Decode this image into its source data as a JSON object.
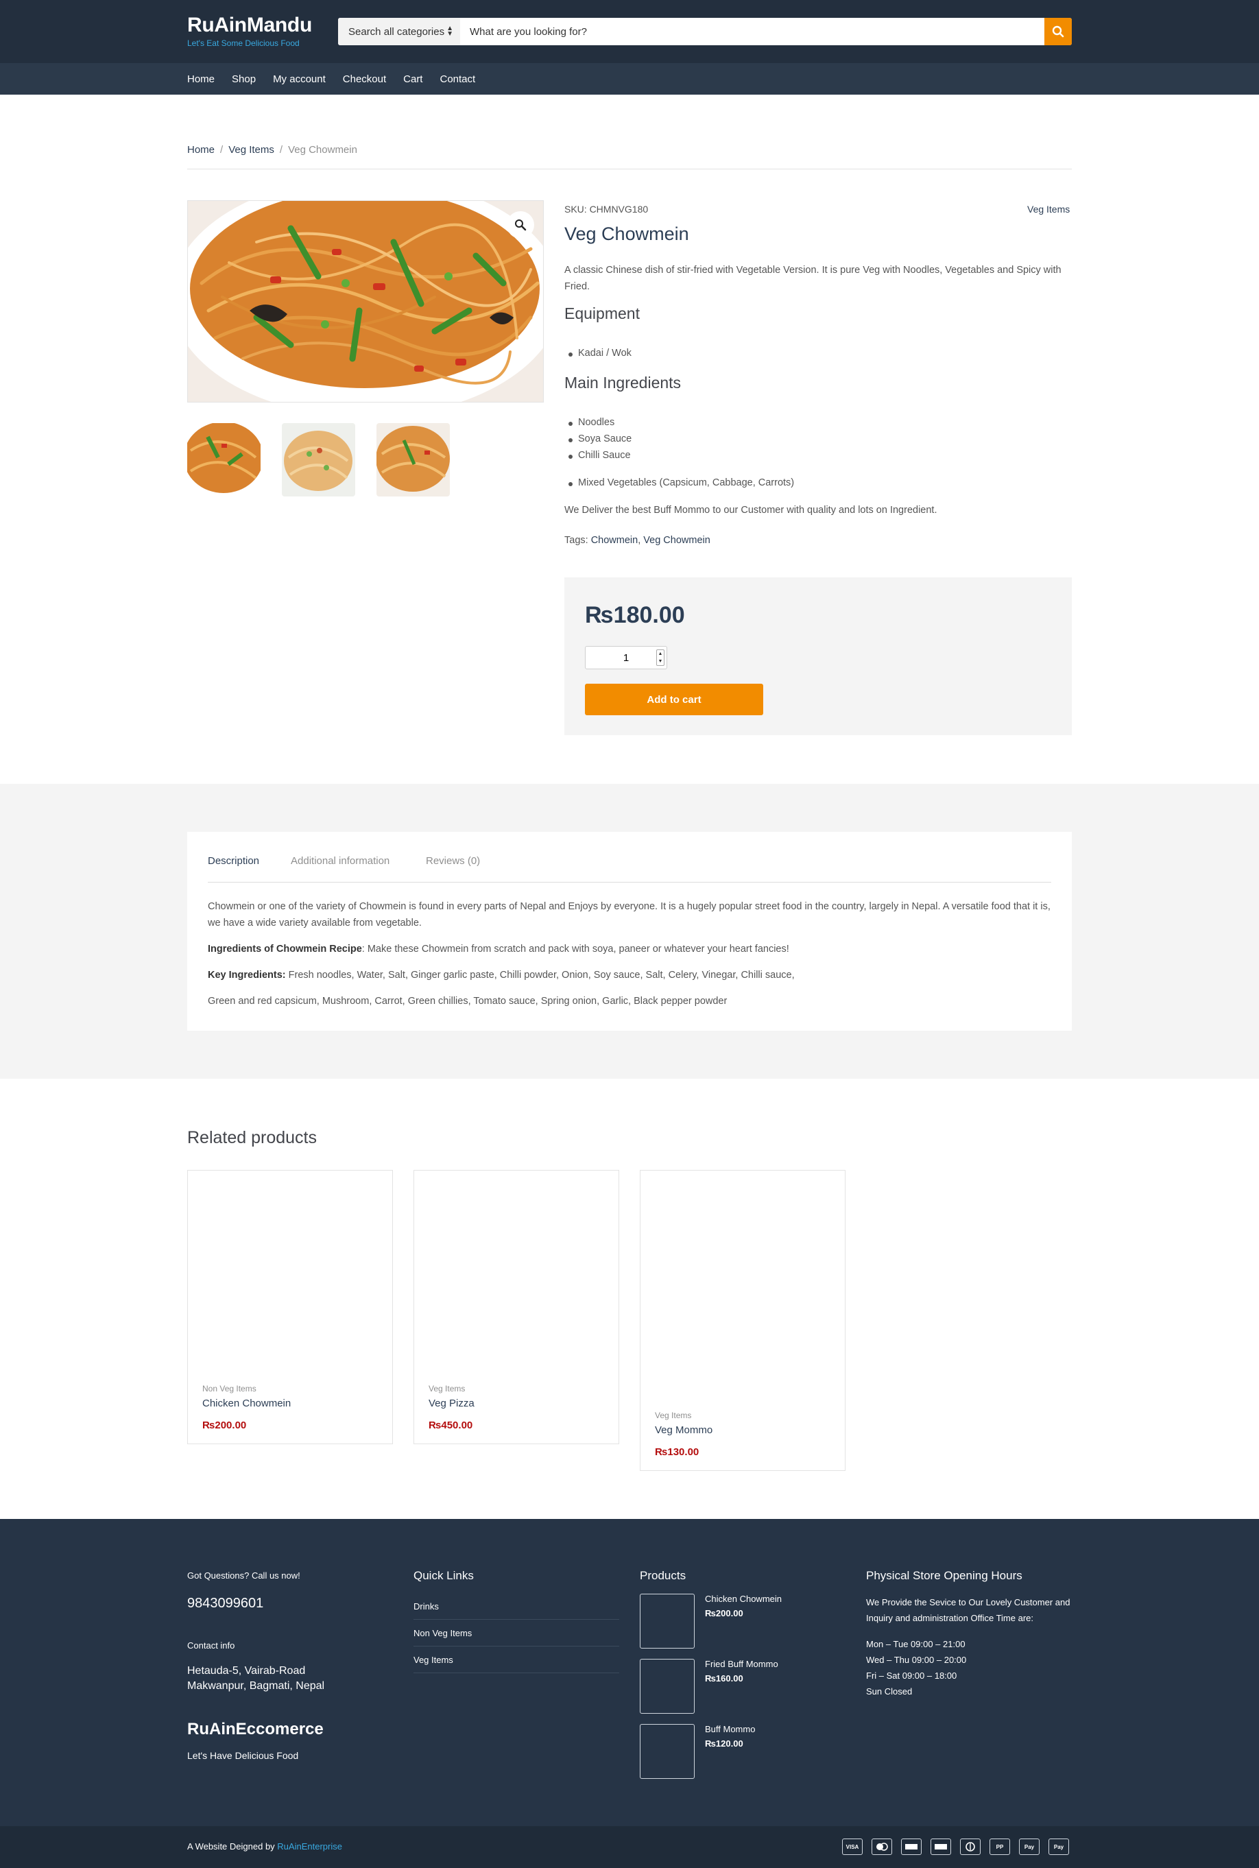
{
  "header": {
    "site_title": "RuAinMandu",
    "tagline": "Let's Eat Some Delicious Food",
    "search_category": "Search all categories",
    "search_placeholder": "What are you looking for?"
  },
  "nav": {
    "items": [
      "Home",
      "Shop",
      "My account",
      "Checkout",
      "Cart",
      "Contact"
    ]
  },
  "breadcrumb": {
    "items": [
      "Home",
      "Veg Items",
      "Veg Chowmein"
    ]
  },
  "product": {
    "sku": "SKU: CHMNVG180",
    "category": "Veg Items",
    "title": "Veg Chowmein",
    "short_description": "A classic Chinese dish of stir-fried with Vegetable Version. It is pure Veg with Noodles, Vegetables and Spicy with Fried.",
    "equipment_heading": "Equipment",
    "equipment": [
      "Kadai / Wok"
    ],
    "ingredients_heading": "Main Ingredients",
    "ingredients": [
      "Noodles",
      "Soya Sauce",
      "Chilli Sauce",
      "Mixed Vegetables (Capsicum, Cabbage, Carrots)"
    ],
    "delivery_note": "We Deliver the best Buff Mommo to our Customer with quality and lots on Ingredient.",
    "tags_label": "Tags:",
    "tags": [
      "Chowmein",
      "Veg Chowmein"
    ],
    "tag_separator": ",",
    "price": "₨180.00",
    "quantity": "1",
    "add_to_cart": "Add to cart"
  },
  "tabs": {
    "items": [
      "Description",
      "Additional information",
      "Reviews (0)"
    ],
    "active": 0,
    "description": {
      "para1": "Chowmein or one of the variety of Chowmein  is found in every parts of Nepal and Enjoys by everyone. It is a hugely popular street food in the country, largely in Nepal. A versatile food that it is, we have a wide variety available from vegetable.",
      "para2_label": "Ingredients of Chowmein Recipe",
      "para2_text": ": Make these Chowmein from scratch and pack with  soya, paneer or whatever your heart fancies!",
      "para3_label": "Key Ingredients:",
      "para3_text": " Fresh noodles, Water, Salt, Ginger garlic paste, Chilli powder, Onion, Soy sauce, Salt, Celery, Vinegar, Chilli sauce,",
      "para4": "Green and red capsicum, Mushroom, Carrot, Green chillies, Tomato sauce, Spring onion, Garlic, Black pepper powder"
    }
  },
  "related": {
    "heading": "Related products",
    "items": [
      {
        "category": "Non Veg Items",
        "name": "Chicken Chowmein",
        "price": "₨200.00"
      },
      {
        "category": "Veg Items",
        "name": "Veg Pizza",
        "price": "₨450.00"
      },
      {
        "category": "Veg Items",
        "name": "Veg Mommo",
        "price": "₨130.00"
      }
    ]
  },
  "footer": {
    "call_label": "Got Questions? Call us now!",
    "phone": "9843099601",
    "contact_label": "Contact info",
    "address_line1": "Hetauda-5, Vairab-Road",
    "address_line2": "Makwanpur, Bagmati, Nepal",
    "brand": "RuAinEccomerce",
    "brand_tagline": "Let's Have Delicious Food",
    "quick_links_heading": "Quick Links",
    "quick_links": [
      "Drinks",
      "Non Veg Items",
      "Veg Items"
    ],
    "products_heading": "Products",
    "products": [
      {
        "name": "Chicken Chowmein",
        "price": "₨200.00"
      },
      {
        "name": "Fried Buff Mommo",
        "price": "₨160.00"
      },
      {
        "name": "Buff Mommo",
        "price": "₨120.00"
      }
    ],
    "hours_heading": "Physical Store Opening Hours",
    "hours_intro": "We Provide the Sevice to Our Lovely Customer and Inquiry and administration Office Time are:",
    "hours": [
      "Mon – Tue 09:00 – 21:00",
      "Wed – Thu 09:00 – 20:00",
      "Fri – Sat 09:00 – 18:00",
      "Sun Closed"
    ],
    "credit_prefix": "A Website Deigned by ",
    "credit_link": "RuAinEnterprise",
    "payment_icons": [
      "visa-icon",
      "mastercard-icon",
      "amex-icon",
      "discover-icon",
      "diners-icon",
      "paypal-icon",
      "apple-pay-icon",
      "google-pay-icon"
    ]
  },
  "colors": {
    "header_bg": "#232f3e",
    "nav_bg": "#2c3a4b",
    "accent": "#f28c00",
    "link": "#2c3e55",
    "price_red": "#b40e0e",
    "footer_bg": "#263446"
  }
}
